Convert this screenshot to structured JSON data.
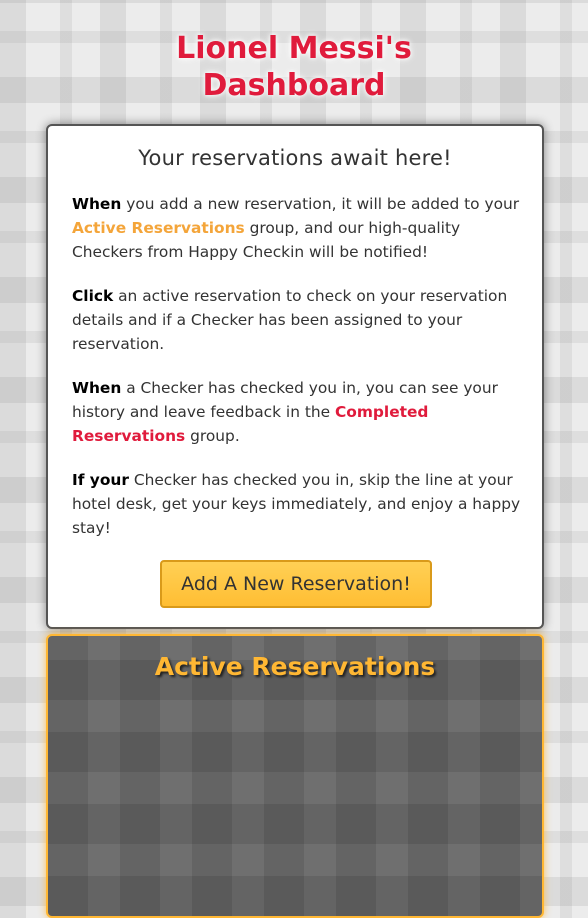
{
  "page": {
    "title_line1": "Lionel Messi's",
    "title_line2": "Dashboard"
  },
  "info_card": {
    "heading": "Your reservations await here!",
    "p1": {
      "lead": "When",
      "text_a": " you add a new reservation, it will be added to your ",
      "highlight": "Active Reservations",
      "text_b": " group, and our high-quality Checkers from Happy Checkin will be notified!"
    },
    "p2": {
      "lead": "Click",
      "text_a": " an active reservation to check on your reservation details and if a Checker has been assigned to your reservation."
    },
    "p3": {
      "lead": "When",
      "text_a": " a Checker has checked you in, you can see your history and leave feedback in the ",
      "highlight": "Completed Reservations",
      "text_b": " group."
    },
    "p4": {
      "lead": "If your",
      "text_a": " Checker has checked you in, skip the line at your hotel desk, get your keys immediately, and enjoy a happy stay!"
    },
    "add_button_label": "Add A New Reservation!"
  },
  "active_reservations": {
    "heading": "Active Reservations"
  },
  "colors": {
    "title_red": "#e01b3c",
    "accent_orange": "#ffb733",
    "highlight_orange": "#f4a53a"
  }
}
